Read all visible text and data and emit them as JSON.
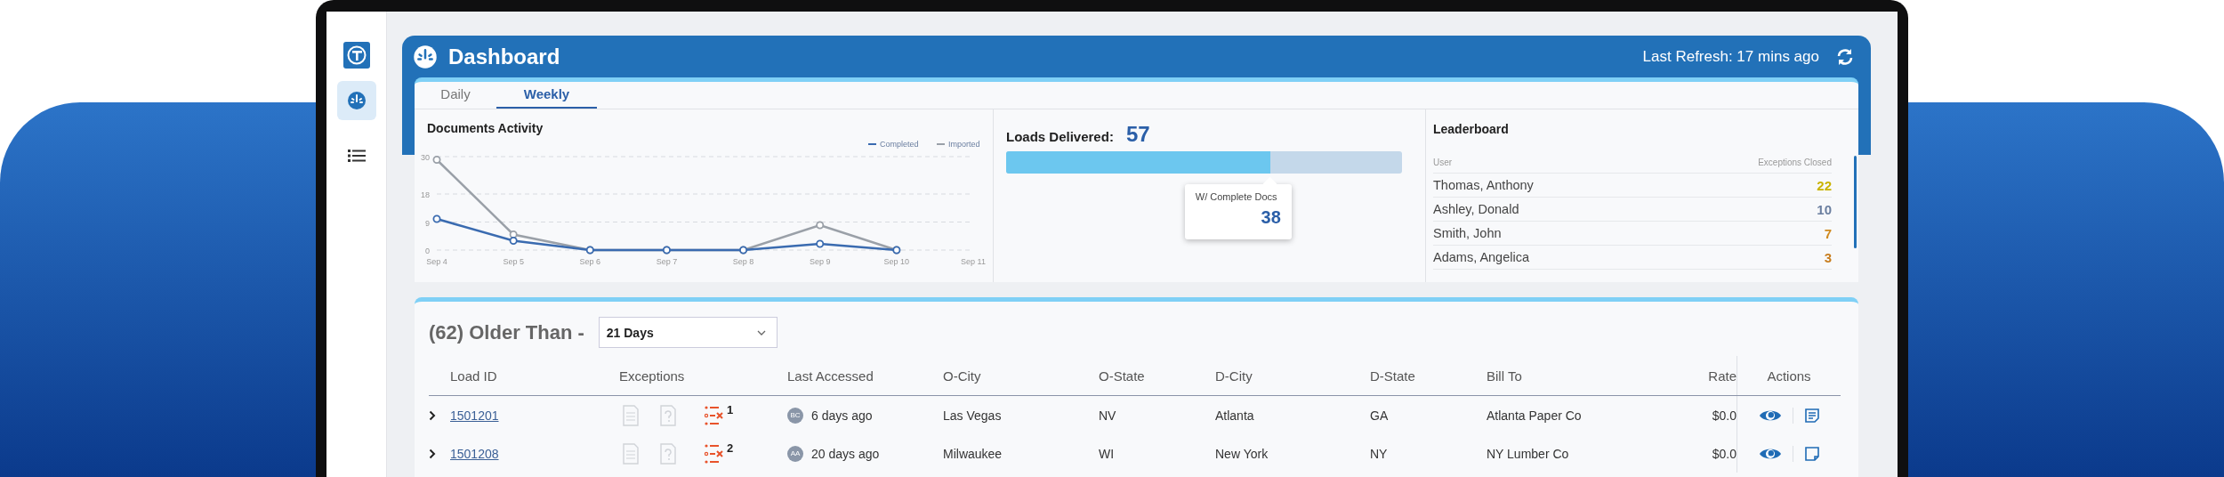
{
  "sidebar": {
    "nav": [
      {
        "kind": "dashboard",
        "selected": true
      },
      {
        "kind": "list",
        "selected": false
      }
    ]
  },
  "header": {
    "title": "Dashboard",
    "last_refresh": "Last Refresh: 17 mins ago"
  },
  "tabs": [
    {
      "label": "Daily",
      "selected": false
    },
    {
      "label": "Weekly",
      "selected": true
    }
  ],
  "documents_activity": {
    "title": "Documents Activity",
    "chart_data": {
      "type": "line",
      "categories": [
        "Sep 4",
        "Sep 5",
        "Sep 6",
        "Sep 7",
        "Sep 8",
        "Sep 9",
        "Sep 10",
        "Sep 11"
      ],
      "ylim": [
        0,
        30
      ],
      "yticks": [
        0,
        9,
        18,
        30
      ],
      "legend": "top-right",
      "series": [
        {
          "name": "Completed",
          "color": "#3a6bb0",
          "marker": "circle",
          "values": [
            10,
            3,
            0,
            0,
            0,
            2,
            0,
            null
          ]
        },
        {
          "name": "Imported",
          "color": "#9aa0a8",
          "marker": "circle",
          "values": [
            29,
            5,
            0,
            0,
            0,
            8,
            0,
            null
          ]
        }
      ]
    }
  },
  "loads": {
    "label": "Loads Delivered:",
    "total": "57",
    "level": 0.667,
    "tooltip_label": "W/ Complete Docs",
    "tooltip_value": "38"
  },
  "leaderboard": {
    "title": "Leaderboard",
    "columns": [
      "User",
      "Exceptions Closed"
    ],
    "rows": [
      {
        "name": "Thomas, Anthony",
        "count": "22",
        "color": "#c9b300"
      },
      {
        "name": "Ashley, Donald",
        "count": "10",
        "color": "#6b7fa0"
      },
      {
        "name": "Smith, John",
        "count": "7",
        "color": "#d08a20"
      },
      {
        "name": "Adams, Angelica",
        "count": "3",
        "color": "#c87d1e"
      }
    ]
  },
  "loads_table": {
    "title": "(62) Older Than -",
    "filter": "21 Days",
    "columns": [
      "Load ID",
      "Exceptions",
      "Last Accessed",
      "O-City",
      "O-State",
      "D-City",
      "D-State",
      "Bill To",
      "Rate",
      "Actions"
    ],
    "rows": [
      {
        "load_id": "1501201",
        "exceptions": "1",
        "avatar": "BC",
        "last_accessed": "6 days ago",
        "o_city": "Las Vegas",
        "o_state": "NV",
        "d_city": "Atlanta",
        "d_state": "GA",
        "bill_to": "Atlanta Paper Co",
        "rate": "$0.0",
        "has_notes": true
      },
      {
        "load_id": "1501208",
        "exceptions": "2",
        "avatar": "AA",
        "last_accessed": "20 days ago",
        "o_city": "Milwaukee",
        "o_state": "WI",
        "d_city": "New York",
        "d_state": "NY",
        "bill_to": "NY Lumber Co",
        "rate": "$0.0",
        "has_notes": false
      }
    ]
  }
}
